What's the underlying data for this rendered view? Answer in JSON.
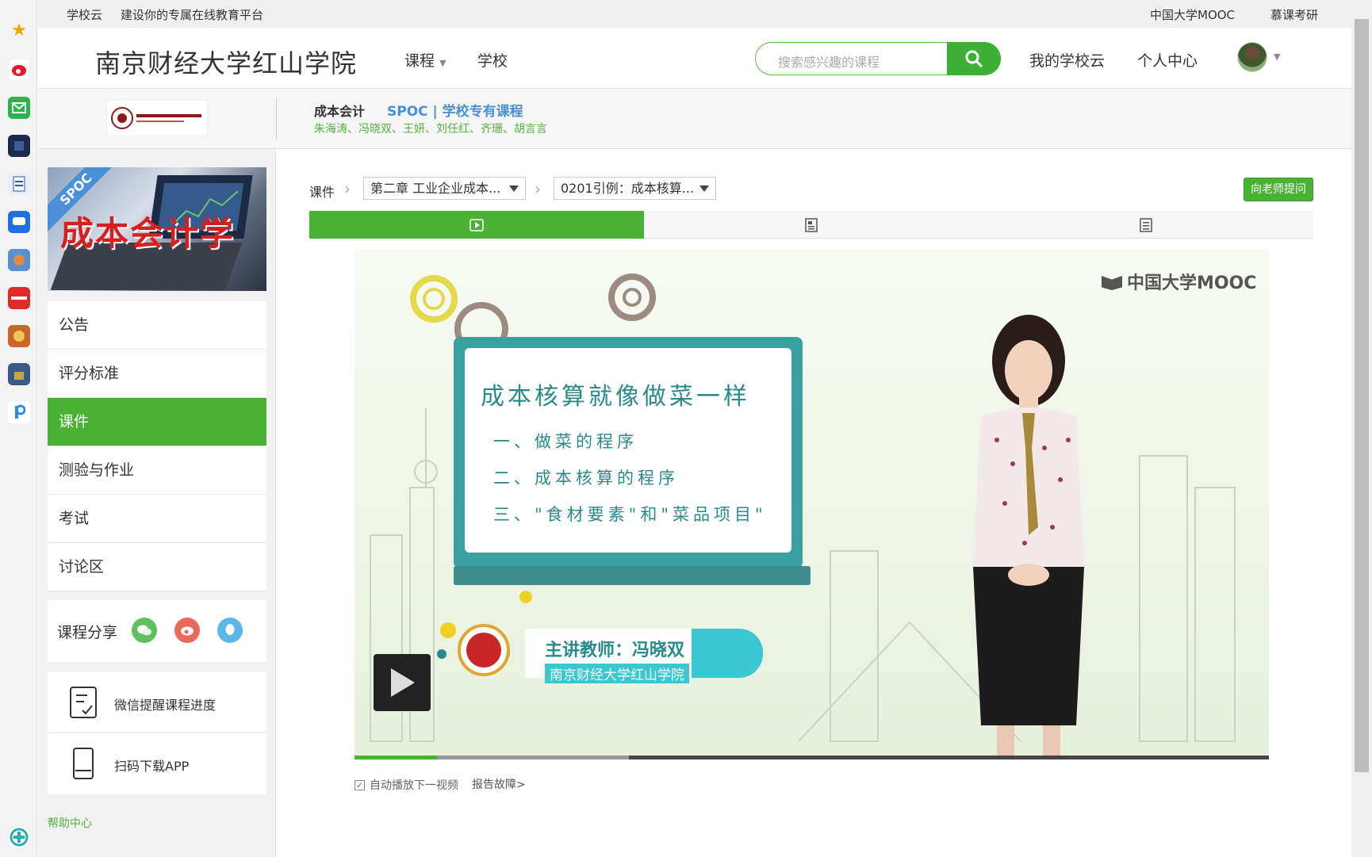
{
  "topstrip": {
    "brand": "学校云",
    "slogan": "建设你的专属在线教育平台",
    "mooc": "中国大学MOOC",
    "kaoyan": "慕课考研"
  },
  "header": {
    "school": "南京财经大学红山学院",
    "nav_course": "课程",
    "nav_school": "学校",
    "search_placeholder": "搜索感兴趣的课程",
    "my_school_cloud": "我的学校云",
    "personal_center": "个人中心"
  },
  "course": {
    "name": "成本会计",
    "spoc_label": "SPOC | 学校专有课程",
    "teachers": "朱海涛、冯晓双、王妍、刘任红、齐珊、胡言言",
    "cover_title": "成本会计学",
    "cover_ribbon": "SPOC"
  },
  "menu": [
    {
      "label": "公告",
      "active": false
    },
    {
      "label": "评分标准",
      "active": false
    },
    {
      "label": "课件",
      "active": true
    },
    {
      "label": "测验与作业",
      "active": false
    },
    {
      "label": "考试",
      "active": false
    },
    {
      "label": "讨论区",
      "active": false
    }
  ],
  "share": {
    "label": "课程分享"
  },
  "tools": {
    "wechat_remind": "微信提醒课程进度",
    "scan_app": "扫码下载APP"
  },
  "help": "帮助中心",
  "breadcrumb": {
    "root": "课件",
    "chapter": "第二章 工业企业成本...",
    "lesson": "0201引例：成本核算..."
  },
  "ask_button": "向老师提问",
  "video": {
    "logo": "中国大学MOOC",
    "board_title": "成本核算就像做菜一样",
    "board_lines": [
      "一、做菜的程序",
      "二、成本核算的程序",
      "三、\"食材要素\"和\"菜品项目\""
    ],
    "lecturer": "主讲教师：冯晓双",
    "lecturer_school": "南京财经大学红山学院",
    "played_fraction": 0.09,
    "buffered_fraction": 0.3
  },
  "below_video": {
    "autoplay": "自动播放下一视频",
    "report": "报告故障>"
  },
  "colors": {
    "accent": "#49b232",
    "spoc_blue": "#4a90d9"
  }
}
